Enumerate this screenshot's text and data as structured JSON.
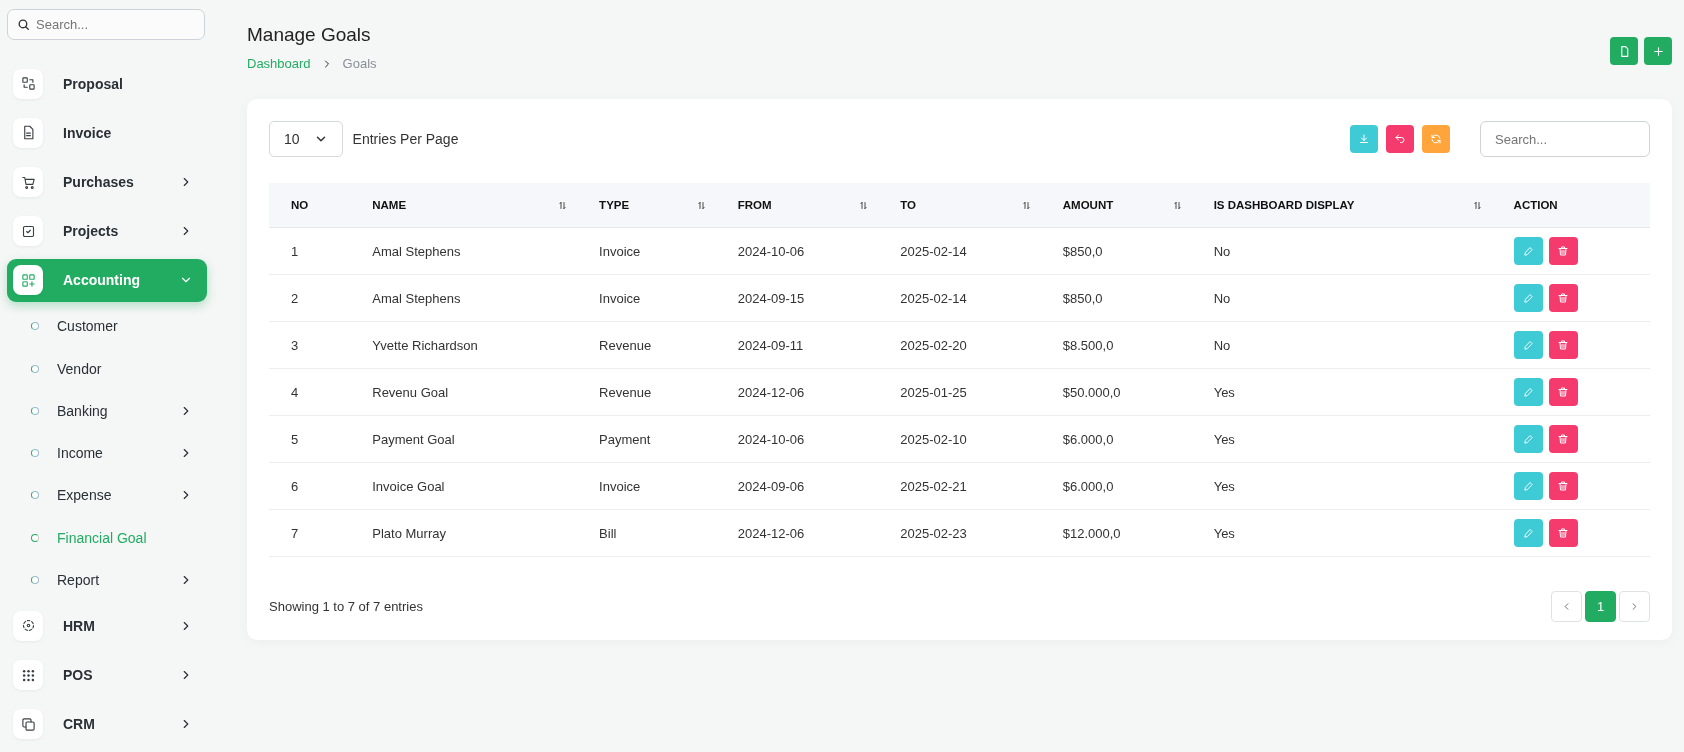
{
  "sidebar": {
    "search": {
      "placeholder": "Search..."
    },
    "items": [
      {
        "label": "Proposal",
        "kind": "main",
        "expandable": false,
        "expanded": false,
        "selected": false
      },
      {
        "label": "Invoice",
        "kind": "main",
        "expandable": false,
        "expanded": false,
        "selected": false
      },
      {
        "label": "Purchases",
        "kind": "main",
        "expandable": true,
        "expanded": false,
        "selected": false
      },
      {
        "label": "Projects",
        "kind": "main",
        "expandable": true,
        "expanded": false,
        "selected": false
      },
      {
        "label": "Accounting",
        "kind": "main",
        "expandable": true,
        "expanded": true,
        "selected": true,
        "children": [
          {
            "label": "Customer",
            "kind": "sub",
            "expandable": false,
            "expanded": false,
            "selected": false
          },
          {
            "label": "Vendor",
            "kind": "sub",
            "expandable": false,
            "expanded": false,
            "selected": false
          },
          {
            "label": "Banking",
            "kind": "sub",
            "expandable": true,
            "expanded": false,
            "selected": false
          },
          {
            "label": "Income",
            "kind": "sub",
            "expandable": true,
            "expanded": false,
            "selected": false
          },
          {
            "label": "Expense",
            "kind": "sub",
            "expandable": true,
            "expanded": false,
            "selected": false
          },
          {
            "label": "Financial Goal",
            "kind": "sub",
            "expandable": false,
            "expanded": false,
            "selected": true
          },
          {
            "label": "Report",
            "kind": "sub",
            "expandable": true,
            "expanded": false,
            "selected": false
          }
        ]
      },
      {
        "label": "HRM",
        "kind": "main",
        "expandable": true,
        "expanded": false,
        "selected": false
      },
      {
        "label": "POS",
        "kind": "main",
        "expandable": true,
        "expanded": false,
        "selected": false
      },
      {
        "label": "CRM",
        "kind": "main",
        "expandable": true,
        "expanded": false,
        "selected": false
      }
    ]
  },
  "page": {
    "title": "Manage Goals",
    "breadcrumb": [
      "Dashboard",
      "Goals"
    ]
  },
  "entries": {
    "value": "10",
    "label": "Entries Per Page"
  },
  "table_search": {
    "placeholder": "Search..."
  },
  "table": {
    "columns": [
      {
        "label": "NO",
        "sortable": false
      },
      {
        "label": "NAME",
        "sortable": true
      },
      {
        "label": "TYPE",
        "sortable": true
      },
      {
        "label": "FROM",
        "sortable": true
      },
      {
        "label": "TO",
        "sortable": true
      },
      {
        "label": "AMOUNT",
        "sortable": true
      },
      {
        "label": "IS DASHBOARD DISPLAY",
        "sortable": true
      },
      {
        "label": "ACTION",
        "sortable": false
      }
    ],
    "rows": [
      [
        "1",
        "Amal Stephens",
        "Invoice",
        "2024-10-06",
        "2025-02-14",
        "$850,0",
        "No"
      ],
      [
        "2",
        "Amal Stephens",
        "Invoice",
        "2024-09-15",
        "2025-02-14",
        "$850,0",
        "No"
      ],
      [
        "3",
        "Yvette Richardson",
        "Revenue",
        "2024-09-11",
        "2025-02-20",
        "$8.500,0",
        "No"
      ],
      [
        "4",
        "Revenu Goal",
        "Revenue",
        "2024-12-06",
        "2025-01-25",
        "$50.000,0",
        "Yes"
      ],
      [
        "5",
        "Payment Goal",
        "Payment",
        "2024-10-06",
        "2025-02-10",
        "$6.000,0",
        "Yes"
      ],
      [
        "6",
        "Invoice Goal",
        "Invoice",
        "2024-09-06",
        "2025-02-21",
        "$6.000,0",
        "Yes"
      ],
      [
        "7",
        "Plato Murray",
        "Bill",
        "2024-12-06",
        "2025-02-23",
        "$12.000,0",
        "Yes"
      ]
    ]
  },
  "footer": {
    "summary": "Showing 1 to 7 of 7 entries",
    "pages": [
      {
        "label": "1",
        "selected": true
      }
    ]
  }
}
